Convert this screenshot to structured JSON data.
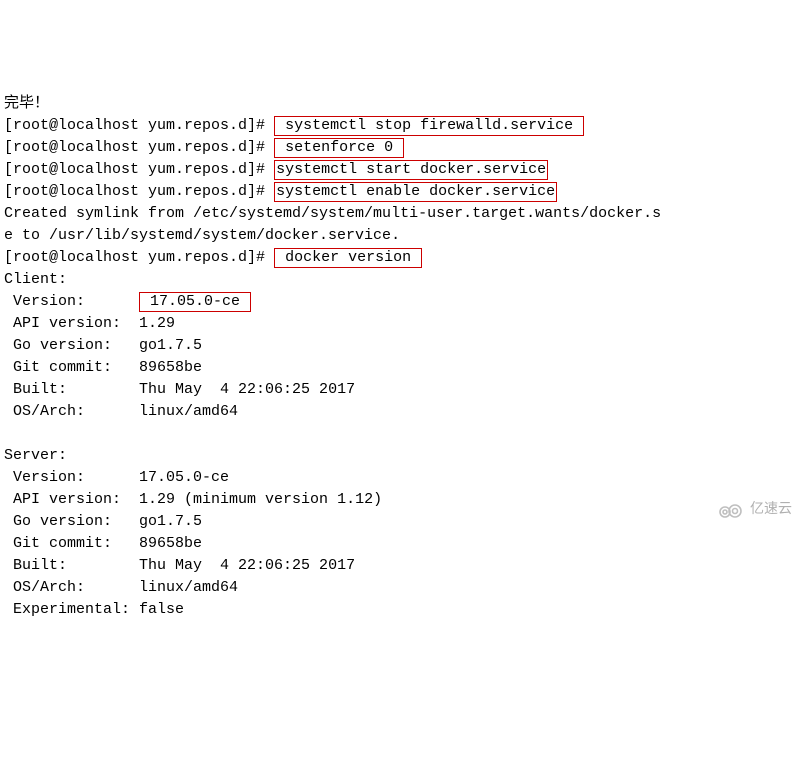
{
  "header": "完毕！",
  "prompt": "[root@localhost yum.repos.d]#",
  "cmds": {
    "c1": " systemctl stop firewalld.service ",
    "c2": " setenforce 0 ",
    "c3": "systemctl start docker.service",
    "c4": "systemctl enable docker.service",
    "c5": " docker version "
  },
  "symlink_l1": "Created symlink from /etc/systemd/system/multi-user.target.wants/docker.s",
  "symlink_l2": "e to /usr/lib/systemd/system/docker.service.",
  "client_title": "Client:",
  "client": {
    "version_label": " Version:     ",
    "version_value": " 17.05.0-ce ",
    "api_label": " API version: ",
    "api_value": " 1.29",
    "go_label": " Go version:  ",
    "go_value": " go1.7.5",
    "git_label": " Git commit:  ",
    "git_value": " 89658be",
    "built_label": " Built:       ",
    "built_value": " Thu May  4 22:06:25 2017",
    "os_label": " OS/Arch:     ",
    "os_value": " linux/amd64"
  },
  "server_title": "Server:",
  "server": {
    "version_label": " Version:     ",
    "version_value": " 17.05.0-ce",
    "api_label": " API version: ",
    "api_value": " 1.29 (minimum version 1.12)",
    "go_label": " Go version:  ",
    "go_value": " go1.7.5",
    "git_label": " Git commit:  ",
    "git_value": " 89658be",
    "built_label": " Built:       ",
    "built_value": " Thu May  4 22:06:25 2017",
    "os_label": " OS/Arch:     ",
    "os_value": " linux/amd64",
    "exp_label": " Experimental:",
    "exp_value": " false"
  },
  "watermark": "亿速云"
}
